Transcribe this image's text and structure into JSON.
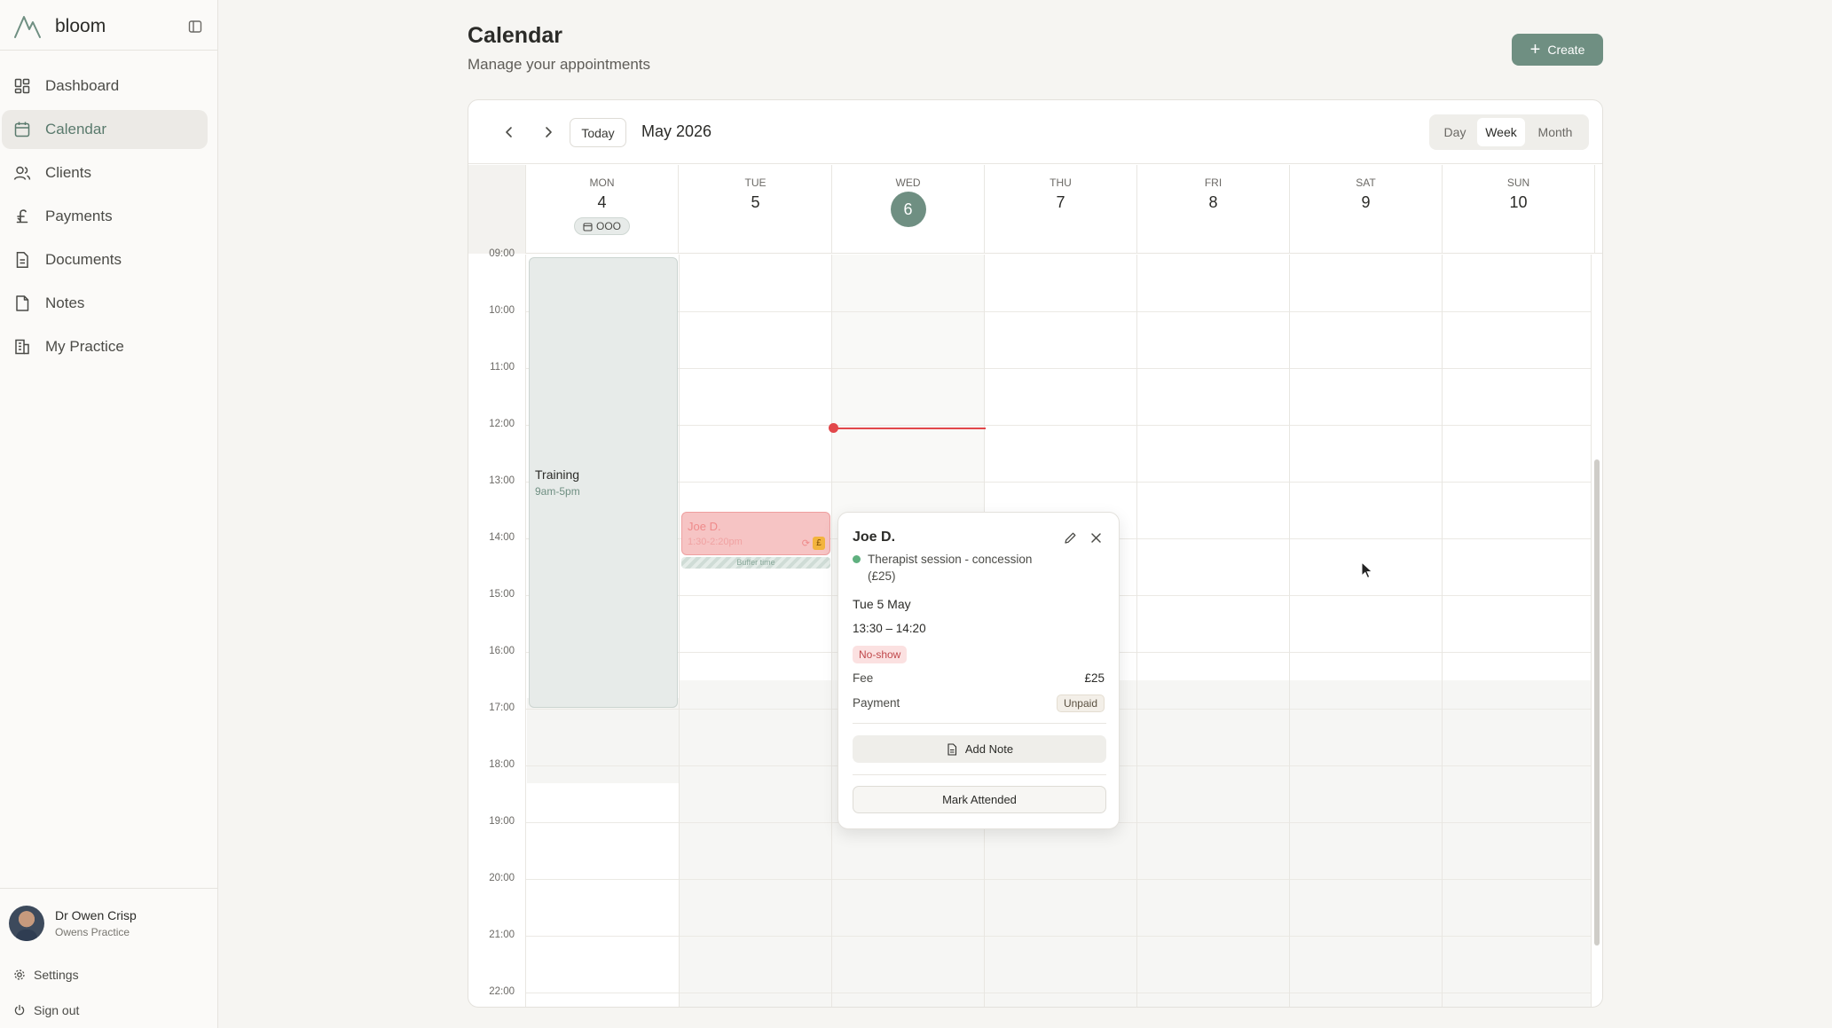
{
  "app": {
    "brand": "bloom"
  },
  "sidebar": {
    "items": [
      {
        "label": "Dashboard",
        "icon": "dashboard-icon"
      },
      {
        "label": "Calendar",
        "icon": "calendar-icon",
        "active": true
      },
      {
        "label": "Clients",
        "icon": "users-icon"
      },
      {
        "label": "Payments",
        "icon": "pound-icon"
      },
      {
        "label": "Documents",
        "icon": "document-icon"
      },
      {
        "label": "Notes",
        "icon": "note-icon"
      },
      {
        "label": "My Practice",
        "icon": "building-icon"
      }
    ],
    "user": {
      "name": "Dr Owen Crisp",
      "practice": "Owens Practice"
    },
    "settings_label": "Settings",
    "signout_label": "Sign out"
  },
  "header": {
    "title": "Calendar",
    "subtitle": "Manage your appointments",
    "create_label": "Create"
  },
  "toolbar": {
    "today_label": "Today",
    "month_label": "May 2026",
    "views": [
      "Day",
      "Week",
      "Month"
    ],
    "selected_view": "Week"
  },
  "days": [
    {
      "dow": "MON",
      "num": "4",
      "badge": "OOO"
    },
    {
      "dow": "TUE",
      "num": "5"
    },
    {
      "dow": "WED",
      "num": "6",
      "today": true
    },
    {
      "dow": "THU",
      "num": "7"
    },
    {
      "dow": "FRI",
      "num": "8"
    },
    {
      "dow": "SAT",
      "num": "9"
    },
    {
      "dow": "SUN",
      "num": "10"
    }
  ],
  "hours": [
    "09:00",
    "10:00",
    "11:00",
    "12:00",
    "13:00",
    "14:00",
    "15:00",
    "16:00",
    "17:00",
    "18:00",
    "19:00",
    "20:00",
    "21:00",
    "22:00"
  ],
  "events": {
    "training": {
      "title": "Training",
      "time": "9am-5pm"
    },
    "appointment": {
      "name": "Joe D.",
      "time": "1:30-2:20pm",
      "fee_badge": "£"
    },
    "buffer_label": "Buffer time"
  },
  "popover": {
    "client": "Joe D.",
    "service": "Therapist session - concession (£25)",
    "date": "Tue 5 May",
    "time": "13:30 – 14:20",
    "status": "No-show",
    "fee_label": "Fee",
    "fee_value": "£25",
    "payment_label": "Payment",
    "payment_value": "Unpaid",
    "add_note_label": "Add Note",
    "mark_attended_label": "Mark Attended"
  },
  "colors": {
    "accent": "#6f8f82",
    "now_line": "#e2474a",
    "appointment": "#f6c4c4",
    "status_dot": "#5fb07f"
  }
}
